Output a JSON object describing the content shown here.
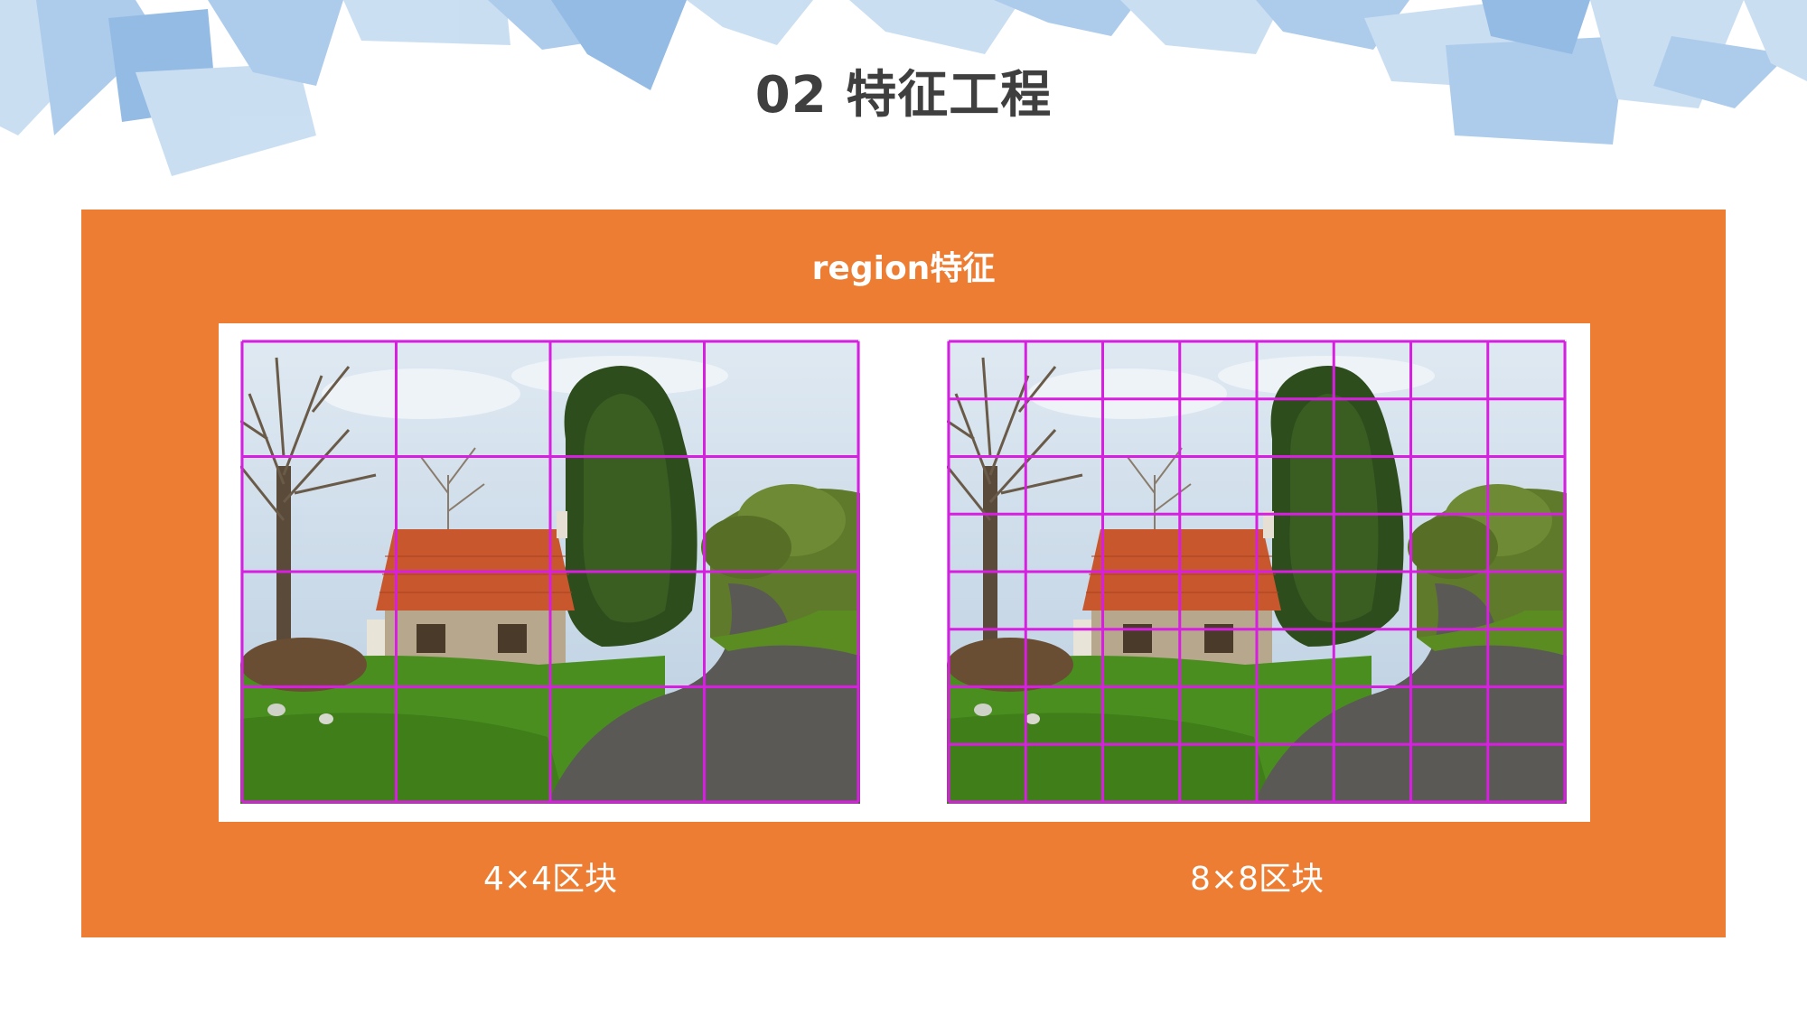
{
  "slide": {
    "title": "02 特征工程"
  },
  "panel": {
    "heading": "region特征",
    "background_color": "#ec7d32"
  },
  "figures": [
    {
      "caption": "4×4区块",
      "grid_rows": 4,
      "grid_cols": 4,
      "grid_color": "#d81ee0"
    },
    {
      "caption": "8×8区块",
      "grid_rows": 8,
      "grid_cols": 8,
      "grid_color": "#d81ee0"
    }
  ],
  "decoration": {
    "shape_colors": [
      "#a9c9ea",
      "#c8ddf2",
      "#8fb8e3"
    ]
  }
}
